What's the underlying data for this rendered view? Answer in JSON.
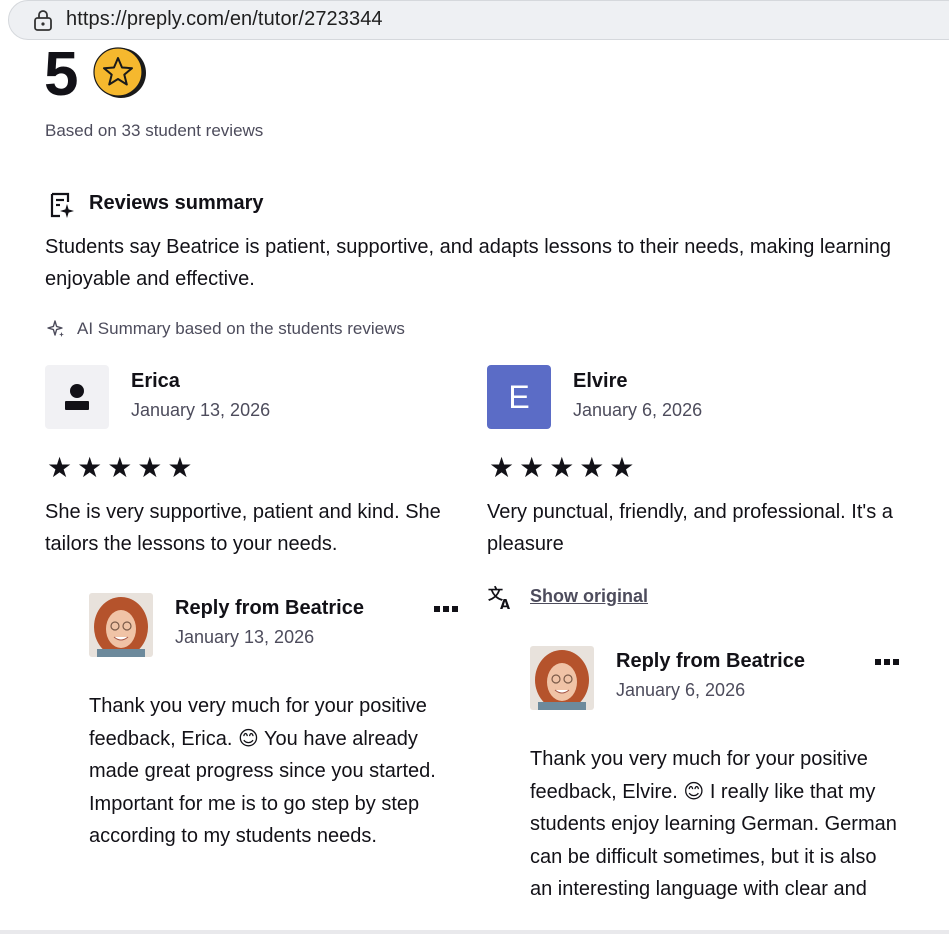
{
  "browser": {
    "url": "https://preply.com/en/tutor/2723344"
  },
  "rating": {
    "value": "5",
    "based_on": "Based on 33 student reviews"
  },
  "summary": {
    "title": "Reviews summary",
    "text": "Students say Beatrice is patient, supportive, and adapts lessons to their needs, making learning enjoyable and effective.",
    "ai_note": "AI Summary based on the students reviews"
  },
  "reviews": [
    {
      "name": "Erica",
      "date": "January 13, 2026",
      "stars": "★★★★★",
      "rating": 5,
      "text": "She is very supportive, patient and kind. She tailors the lessons to your needs.",
      "reply": {
        "title": "Reply from Beatrice",
        "date": "January 13, 2026",
        "text": "Thank you very much for your positive feedback, Erica. 😊 You have already made great progress since you started. Important for me is to go step by step according to my students needs."
      }
    },
    {
      "name": "Elvire",
      "avatar_letter": "E",
      "date": "January 6, 2026",
      "stars": "★★★★★",
      "rating": 5,
      "text": "Very punctual, friendly, and professional. It's a pleasure",
      "show_original": "Show original",
      "reply": {
        "title": "Reply from Beatrice",
        "date": "January 6, 2026",
        "text": "Thank you very much for your positive feedback, Elvire. 😊 I really like that my students enjoy learning German. German can be difficult sometimes, but it is also an interesting language with clear and"
      }
    }
  ],
  "colors": {
    "text": "#121117",
    "muted": "#4d4c5c",
    "avatar_letter_bg": "#5b6cc6",
    "star_gold": "#f5b82e"
  },
  "icons": {
    "lock": "lock-icon",
    "rating_star": "gold-star-icon",
    "summary": "ai-summary-icon",
    "sparkle": "sparkle-icon",
    "user": "user-placeholder-icon",
    "translate": "translate-icon",
    "more": "more-options-icon"
  }
}
